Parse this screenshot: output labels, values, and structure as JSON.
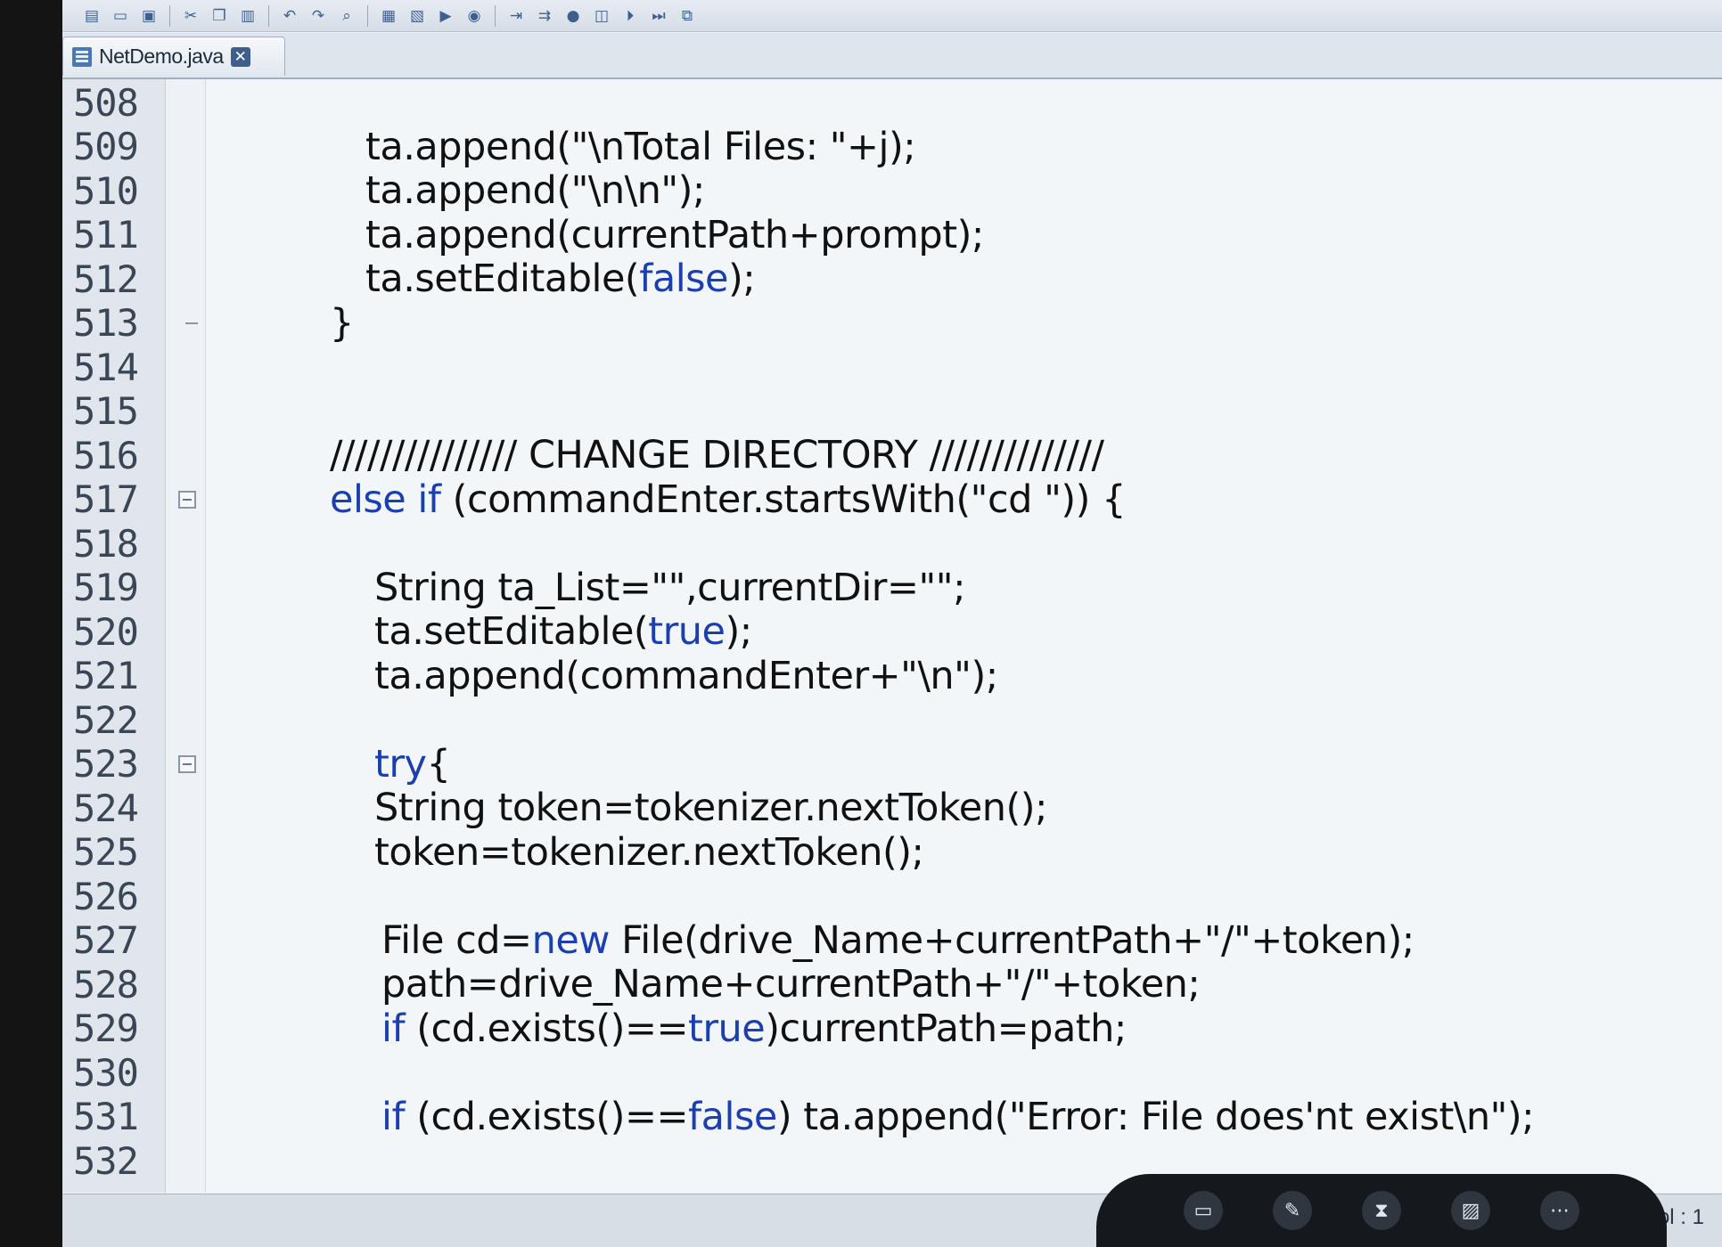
{
  "toolbar": {
    "icons": [
      "toolbar-icon",
      "toolbar-icon",
      "toolbar-icon",
      "toolbar-icon",
      "toolbar-icon"
    ]
  },
  "editor_tab": {
    "filename": "NetDemo.java",
    "close_glyph": "✕"
  },
  "code_lines": [
    {
      "num": "508",
      "text": ""
    },
    {
      "num": "509",
      "text": "ta.append(\"\\nTotal Files: \"+j);"
    },
    {
      "num": "510",
      "text": "ta.append(\"\\n\\n\");"
    },
    {
      "num": "511",
      "text": "ta.append(currentPath+prompt);"
    },
    {
      "num": "512",
      "pre": "ta.setEditable(",
      "kw": "false",
      "post": ");"
    },
    {
      "num": "513",
      "text": "}"
    },
    {
      "num": "514",
      "text": ""
    },
    {
      "num": "515",
      "text": ""
    },
    {
      "num": "516",
      "text": "/////////////// CHANGE DIRECTORY //////////////"
    },
    {
      "num": "517",
      "kw1": "else if",
      "post": " (commandEnter.startsWith(\"cd \")) {"
    },
    {
      "num": "518",
      "text": ""
    },
    {
      "num": "519",
      "text": "String ta_List=\"\",currentDir=\"\";"
    },
    {
      "num": "520",
      "pre": "ta.setEditable(",
      "kw": "true",
      "post": ");"
    },
    {
      "num": "521",
      "text": "ta.append(commandEnter+\"\\n\");"
    },
    {
      "num": "522",
      "text": ""
    },
    {
      "num": "523",
      "kw1": "try",
      "post": "{"
    },
    {
      "num": "524",
      "text": "String token=tokenizer.nextToken();"
    },
    {
      "num": "525",
      "text": "token=tokenizer.nextToken();"
    },
    {
      "num": "526",
      "text": ""
    },
    {
      "num": "527",
      "pre": "File cd=",
      "kw": "new",
      "post": " File(drive_Name+currentPath+\"/\"+token);"
    },
    {
      "num": "528",
      "text": "path=drive_Name+currentPath+\"/\"+token;"
    },
    {
      "num": "529",
      "kw1": "if",
      "pre2": " (cd.exists()==",
      "kw": "true",
      "post": ")currentPath=path;"
    },
    {
      "num": "530",
      "text": ""
    },
    {
      "num": "531",
      "kw1": "if",
      "pre2": " (cd.exists()==",
      "kw": "false",
      "post": ") ta.append(\"Error: File does'nt exist\\n\");"
    },
    {
      "num": "532",
      "text": ""
    }
  ],
  "status": {
    "col": "Col : 1"
  },
  "colors": {
    "keyword": "#1c3fb0",
    "text": "#111111",
    "line_number": "#3a4656"
  }
}
